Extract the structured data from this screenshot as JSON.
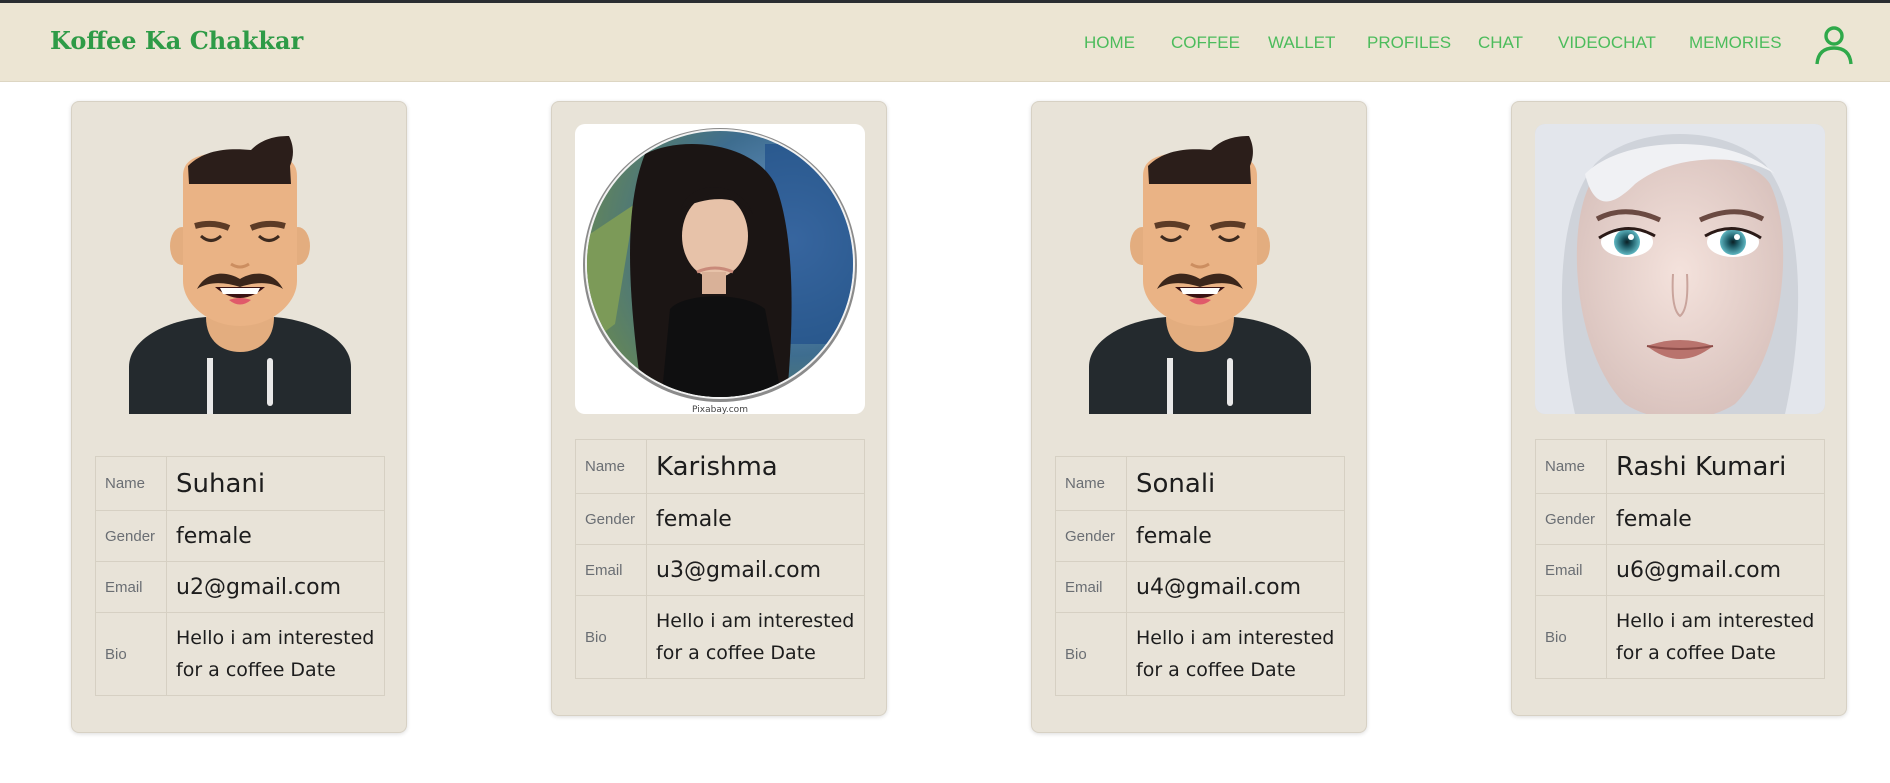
{
  "brand": "Koffee Ka Chakkar",
  "nav": [
    "HOME",
    "COFFEE",
    "WALLET",
    "PROFILES",
    "CHAT",
    "VIDEOCHAT",
    "MEMORIES"
  ],
  "colors": {
    "brand": "#2e9b47",
    "nav_link": "#4cbc5c",
    "navbar_bg": "#ece5d3",
    "card_bg": "#e8e3d8"
  },
  "labels": {
    "name": "Name",
    "gender": "Gender",
    "email": "Email",
    "bio": "Bio"
  },
  "profiles": [
    {
      "name": "Suhani",
      "gender": "female",
      "email": "u2@gmail.com",
      "bio": "Hello i am interested for a coffee Date",
      "photo": "cartoon-avatar"
    },
    {
      "name": "Karishma",
      "gender": "female",
      "email": "u3@gmail.com",
      "bio": "Hello i am interested for a coffee Date",
      "photo": "round-portrait-photo",
      "watermark": "Pixabay.com"
    },
    {
      "name": "Sonali",
      "gender": "female",
      "email": "u4@gmail.com",
      "bio": "Hello i am interested for a coffee Date",
      "photo": "cartoon-avatar"
    },
    {
      "name": "Rashi Kumari",
      "gender": "female",
      "email": "u6@gmail.com",
      "bio": "Hello i am interested for a coffee Date",
      "photo": "face-portrait-photo"
    }
  ]
}
